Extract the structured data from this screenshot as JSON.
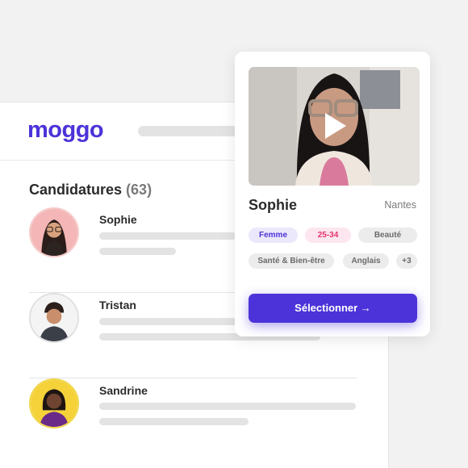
{
  "app": {
    "logo_text": "moggo"
  },
  "applications": {
    "title": "Candidatures",
    "count": "(63)",
    "candidates": [
      {
        "name": "Sophie"
      },
      {
        "name": "Tristan"
      },
      {
        "name": "Sandrine"
      }
    ]
  },
  "profile_card": {
    "name": "Sophie",
    "city": "Nantes",
    "tags": [
      "Femme",
      "25-34",
      "Beauté",
      "Santé & Bien-être",
      "Anglais",
      "+3"
    ],
    "select_label": "Sélectionner →"
  },
  "colors": {
    "brand": "#4b33d9",
    "tag_purple_bg": "#ece8fc",
    "tag_pink_bg": "#fde6ef",
    "tag_pink_text": "#e2336c"
  }
}
